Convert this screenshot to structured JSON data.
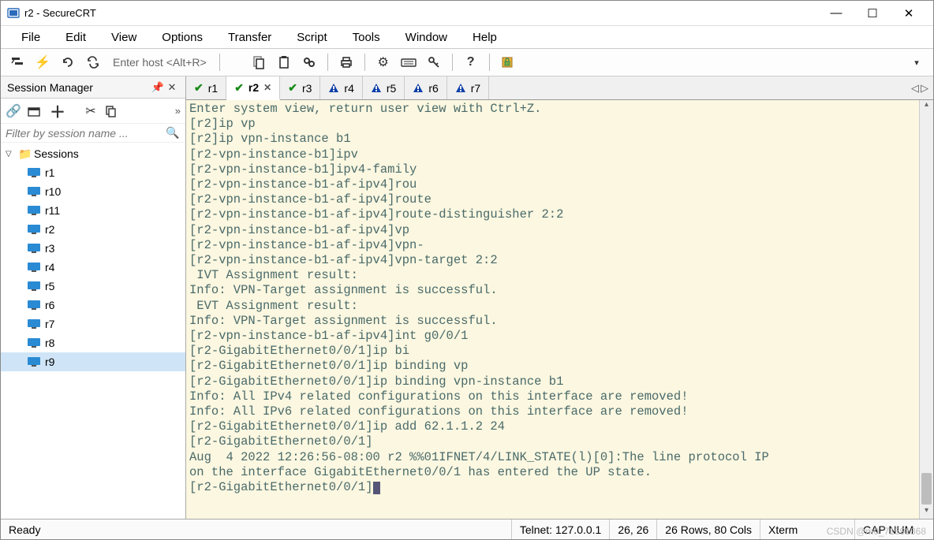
{
  "window": {
    "title": "r2 - SecureCRT"
  },
  "menu": [
    "File",
    "Edit",
    "View",
    "Options",
    "Transfer",
    "Script",
    "Tools",
    "Window",
    "Help"
  ],
  "host_hint": "Enter host <Alt+R>",
  "session_manager": {
    "title": "Session Manager",
    "filter_placeholder": "Filter by session name ...",
    "root": "Sessions",
    "items": [
      "r1",
      "r10",
      "r11",
      "r2",
      "r3",
      "r4",
      "r5",
      "r6",
      "r7",
      "r8",
      "r9"
    ],
    "selected": "r9"
  },
  "tabs": [
    {
      "label": "r1",
      "status": "ok"
    },
    {
      "label": "r2",
      "status": "ok",
      "active": true,
      "closable": true
    },
    {
      "label": "r3",
      "status": "ok"
    },
    {
      "label": "r4",
      "status": "warn"
    },
    {
      "label": "r5",
      "status": "warn"
    },
    {
      "label": "r6",
      "status": "warn"
    },
    {
      "label": "r7",
      "status": "warn"
    }
  ],
  "terminal_lines": [
    "Enter system view, return user view with Ctrl+Z.",
    "[r2]ip vp",
    "[r2]ip vpn-instance b1",
    "[r2-vpn-instance-b1]ipv",
    "[r2-vpn-instance-b1]ipv4-family",
    "[r2-vpn-instance-b1-af-ipv4]rou",
    "[r2-vpn-instance-b1-af-ipv4]route",
    "[r2-vpn-instance-b1-af-ipv4]route-distinguisher 2:2",
    "[r2-vpn-instance-b1-af-ipv4]vp",
    "[r2-vpn-instance-b1-af-ipv4]vpn-",
    "[r2-vpn-instance-b1-af-ipv4]vpn-target 2:2",
    " IVT Assignment result:",
    "Info: VPN-Target assignment is successful.",
    " EVT Assignment result:",
    "Info: VPN-Target assignment is successful.",
    "[r2-vpn-instance-b1-af-ipv4]int g0/0/1",
    "[r2-GigabitEthernet0/0/1]ip bi",
    "[r2-GigabitEthernet0/0/1]ip binding vp",
    "[r2-GigabitEthernet0/0/1]ip binding vpn-instance b1",
    "Info: All IPv4 related configurations on this interface are removed!",
    "Info: All IPv6 related configurations on this interface are removed!",
    "[r2-GigabitEthernet0/0/1]ip add 62.1.1.2 24",
    "[r2-GigabitEthernet0/0/1]",
    "Aug  4 2022 12:26:56-08:00 r2 %%01IFNET/4/LINK_STATE(l)[0]:The line protocol IP",
    "on the interface GigabitEthernet0/0/1 has entered the UP state.",
    "[r2-GigabitEthernet0/0/1]"
  ],
  "status": {
    "ready": "Ready",
    "conn": "Telnet: 127.0.0.1",
    "pos": "26,  26",
    "size": "26 Rows, 80 Cols",
    "term": "Xterm",
    "encoding": "CAP  NUM"
  },
  "watermark": "CSDN @m0_71591368"
}
